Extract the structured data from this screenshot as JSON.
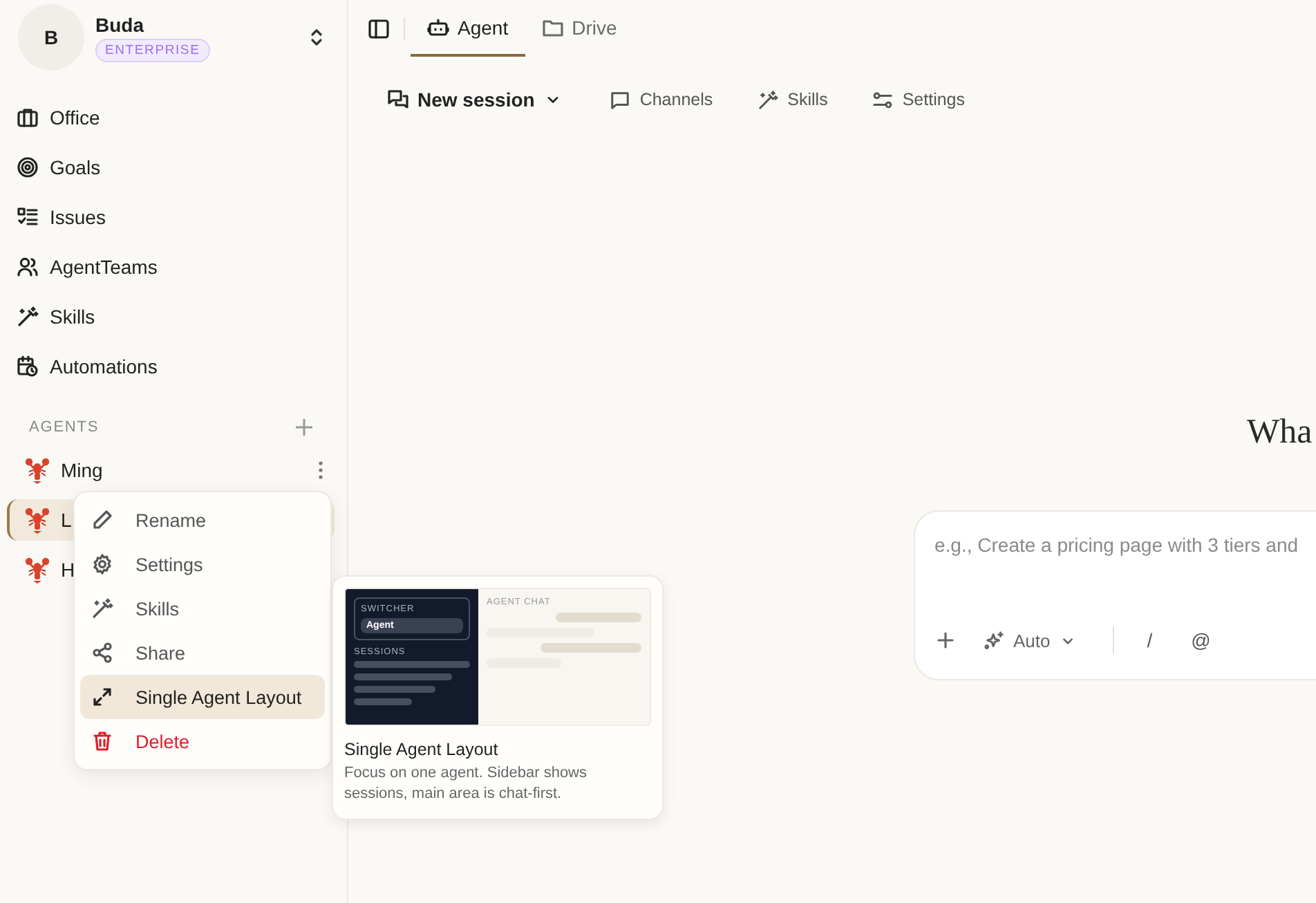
{
  "workspace": {
    "avatar": "B",
    "name": "Buda",
    "plan": "ENTERPRISE"
  },
  "nav": [
    {
      "label": "Office"
    },
    {
      "label": "Goals"
    },
    {
      "label": "Issues"
    },
    {
      "label": "AgentTeams"
    },
    {
      "label": "Skills"
    },
    {
      "label": "Automations"
    }
  ],
  "agents_title": "AGENTS",
  "agents": [
    {
      "name": "Ming",
      "selected": false
    },
    {
      "name": "L",
      "selected": true
    },
    {
      "name": "H",
      "selected": false
    }
  ],
  "context_menu": [
    {
      "label": "Rename",
      "kind": "normal",
      "selected": false
    },
    {
      "label": "Settings",
      "kind": "normal",
      "selected": false
    },
    {
      "label": "Skills",
      "kind": "normal",
      "selected": false
    },
    {
      "label": "Share",
      "kind": "normal",
      "selected": false
    },
    {
      "label": "Single Agent Layout",
      "kind": "normal",
      "selected": true
    },
    {
      "label": "Delete",
      "kind": "danger",
      "selected": false
    }
  ],
  "preview": {
    "switcher_label": "SWITCHER",
    "switcher_item": "Agent",
    "sessions_label": "SESSIONS",
    "chat_label": "AGENT CHAT",
    "title": "Single Agent Layout",
    "description": "Focus on one agent. Sidebar shows sessions, main area is chat-first."
  },
  "tabs": [
    {
      "label": "Agent",
      "selected": true
    },
    {
      "label": "Drive",
      "selected": false
    }
  ],
  "toolbar": {
    "session": "New session",
    "links": [
      "Channels",
      "Skills",
      "Settings"
    ]
  },
  "heading": "Wha",
  "composer": {
    "placeholder": "e.g., Create a pricing page with 3 tiers and",
    "mode": "Auto",
    "slash": "/",
    "mention": "@"
  }
}
